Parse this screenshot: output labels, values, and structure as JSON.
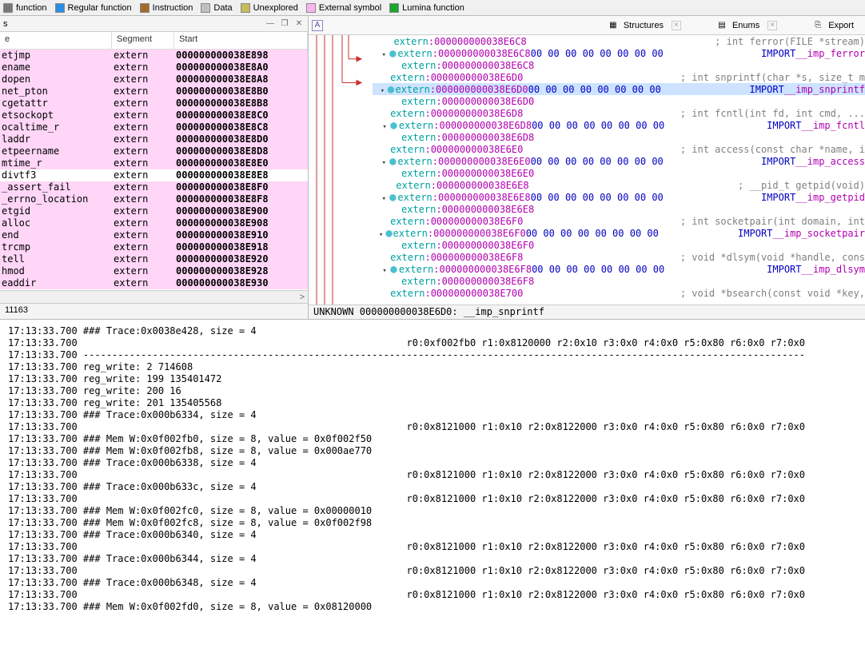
{
  "legend": [
    {
      "label": "function",
      "color": "#777777"
    },
    {
      "label": "Regular function",
      "color": "#2b8de6"
    },
    {
      "label": "Instruction",
      "color": "#a56a2a"
    },
    {
      "label": "Data",
      "color": "#c0c0c0"
    },
    {
      "label": "Unexplored",
      "color": "#c8bb5a"
    },
    {
      "label": "External symbol",
      "color": "#f7b6ef"
    },
    {
      "label": "Lumina function",
      "color": "#19a62a"
    }
  ],
  "left": {
    "title": "s",
    "headers": {
      "name": "e",
      "seg": "Segment",
      "start": "Start"
    },
    "rows": [
      {
        "n": "etjmp",
        "s": "extern",
        "a": "000000000038E898",
        "hl": true
      },
      {
        "n": "ename",
        "s": "extern",
        "a": "000000000038E8A0",
        "hl": true
      },
      {
        "n": "dopen",
        "s": "extern",
        "a": "000000000038E8A8",
        "hl": true
      },
      {
        "n": "net_pton",
        "s": "extern",
        "a": "000000000038E8B0",
        "hl": true
      },
      {
        "n": "cgetattr",
        "s": "extern",
        "a": "000000000038E8B8",
        "hl": true
      },
      {
        "n": "etsockopt",
        "s": "extern",
        "a": "000000000038E8C0",
        "hl": true
      },
      {
        "n": "ocaltime_r",
        "s": "extern",
        "a": "000000000038E8C8",
        "hl": true
      },
      {
        "n": "laddr",
        "s": "extern",
        "a": "000000000038E8D0",
        "hl": true
      },
      {
        "n": "etpeername",
        "s": "extern",
        "a": "000000000038E8D8",
        "hl": true
      },
      {
        "n": "mtime_r",
        "s": "extern",
        "a": "000000000038E8E0",
        "hl": true
      },
      {
        "n": "divtf3",
        "s": "extern",
        "a": "000000000038E8E8",
        "hl": false
      },
      {
        "n": "_assert_fail",
        "s": "extern",
        "a": "000000000038E8F0",
        "hl": true
      },
      {
        "n": "_errno_location",
        "s": "extern",
        "a": "000000000038E8F8",
        "hl": true
      },
      {
        "n": "etgid",
        "s": "extern",
        "a": "000000000038E900",
        "hl": true
      },
      {
        "n": "alloc",
        "s": "extern",
        "a": "000000000038E908",
        "hl": true
      },
      {
        "n": "end",
        "s": "extern",
        "a": "000000000038E910",
        "hl": true
      },
      {
        "n": "trcmp",
        "s": "extern",
        "a": "000000000038E918",
        "hl": true
      },
      {
        "n": "tell",
        "s": "extern",
        "a": "000000000038E920",
        "hl": true
      },
      {
        "n": "hmod",
        "s": "extern",
        "a": "000000000038E928",
        "hl": true
      },
      {
        "n": "eaddir",
        "s": "extern",
        "a": "000000000038E930",
        "hl": true
      }
    ],
    "status": "11163"
  },
  "tabs": [
    {
      "name": "Structures"
    },
    {
      "name": "Enums"
    },
    {
      "name": "Export"
    }
  ],
  "disasm": {
    "lines": [
      {
        "addr": "000000000038E6C8",
        "extra": "",
        "cmt": "; int ferror(FILE *stream)",
        "chev": false,
        "bul": false
      },
      {
        "addr": "000000000038E6C8",
        "bytes": "00 00 00 00 00 00 00 00",
        "imp": "__imp_ferror",
        "chev": true,
        "bul": "cy"
      },
      {
        "addr": "000000000038E6C8",
        "extra": "",
        "chev": false,
        "bul": false
      },
      {
        "addr": "000000000038E6D0",
        "extra": "",
        "cmt": "; int snprintf(char *s, size_t m",
        "chev": false,
        "bul": false
      },
      {
        "addr": "000000000038E6D0",
        "bytes": "00 00 00 00 00 00 00 00",
        "imp": "__imp_snprintf",
        "chev": true,
        "bul": "cy",
        "sel": true
      },
      {
        "addr": "000000000038E6D0",
        "extra": "",
        "chev": false,
        "bul": false
      },
      {
        "addr": "000000000038E6D8",
        "extra": "",
        "cmt": "; int fcntl(int fd, int cmd, ...",
        "chev": false,
        "bul": false
      },
      {
        "addr": "000000000038E6D8",
        "bytes": "00 00 00 00 00 00 00 00",
        "imp": "__imp_fcntl",
        "chev": true,
        "bul": "cy"
      },
      {
        "addr": "000000000038E6D8",
        "extra": "",
        "chev": false,
        "bul": false
      },
      {
        "addr": "000000000038E6E0",
        "extra": "",
        "cmt": "; int access(const char *name, i",
        "chev": false,
        "bul": false
      },
      {
        "addr": "000000000038E6E0",
        "bytes": "00 00 00 00 00 00 00 00",
        "imp": "__imp_access",
        "chev": true,
        "bul": "cy"
      },
      {
        "addr": "000000000038E6E0",
        "extra": "",
        "chev": false,
        "bul": false
      },
      {
        "addr": "000000000038E6E8",
        "extra": "",
        "cmt": "; __pid_t getpid(void)",
        "chev": false,
        "bul": false
      },
      {
        "addr": "000000000038E6E8",
        "bytes": "00 00 00 00 00 00 00 00",
        "imp": "__imp_getpid",
        "chev": true,
        "bul": "cy"
      },
      {
        "addr": "000000000038E6E8",
        "extra": "",
        "chev": false,
        "bul": false
      },
      {
        "addr": "000000000038E6F0",
        "extra": "",
        "cmt": "; int socketpair(int domain, int",
        "chev": false,
        "bul": false
      },
      {
        "addr": "000000000038E6F0",
        "bytes": "00 00 00 00 00 00 00 00",
        "imp": "__imp_socketpair",
        "chev": true,
        "bul": "cy"
      },
      {
        "addr": "000000000038E6F0",
        "extra": "",
        "chev": false,
        "bul": false
      },
      {
        "addr": "000000000038E6F8",
        "extra": "",
        "cmt": "; void *dlsym(void *handle, cons",
        "chev": false,
        "bul": false
      },
      {
        "addr": "000000000038E6F8",
        "bytes": "00 00 00 00 00 00 00 00",
        "imp": "__imp_dlsym",
        "chev": true,
        "bul": "cy"
      },
      {
        "addr": "000000000038E6F8",
        "extra": "",
        "chev": false,
        "bul": false
      },
      {
        "addr": "000000000038E700",
        "extra": "",
        "cmt": "; void *bsearch(const void *key,",
        "chev": false,
        "bul": false
      }
    ],
    "status": "UNKNOWN 000000000038E6D0: __imp_snprintf"
  },
  "log": [
    "17:13:33.700 ### Trace:0x0038e428, size = 4",
    "17:13:33.700                                                         r0:0xf002fb0 r1:0x8120000 r2:0x10 r3:0x0 r4:0x0 r5:0x80 r6:0x0 r7:0x0",
    "17:13:33.700 -----------------------------------------------------------------------------------------------------------------------------",
    "17:13:33.700 reg_write: 2 714608",
    "17:13:33.700 reg_write: 199 135401472",
    "17:13:33.700 reg_write: 200 16",
    "17:13:33.700 reg_write: 201 135405568",
    "17:13:33.700 ### Trace:0x000b6334, size = 4",
    "17:13:33.700                                                         r0:0x8121000 r1:0x10 r2:0x8122000 r3:0x0 r4:0x0 r5:0x80 r6:0x0 r7:0x0",
    "17:13:33.700 ### Mem W:0x0f002fb0, size = 8, value = 0x0f002f50",
    "17:13:33.700 ### Mem W:0x0f002fb8, size = 8, value = 0x000ae770",
    "17:13:33.700 ### Trace:0x000b6338, size = 4",
    "17:13:33.700                                                         r0:0x8121000 r1:0x10 r2:0x8122000 r3:0x0 r4:0x0 r5:0x80 r6:0x0 r7:0x0",
    "17:13:33.700 ### Trace:0x000b633c, size = 4",
    "17:13:33.700                                                         r0:0x8121000 r1:0x10 r2:0x8122000 r3:0x0 r4:0x0 r5:0x80 r6:0x0 r7:0x0",
    "17:13:33.700 ### Mem W:0x0f002fc0, size = 8, value = 0x00000010",
    "17:13:33.700 ### Mem W:0x0f002fc8, size = 8, value = 0x0f002f98",
    "17:13:33.700 ### Trace:0x000b6340, size = 4",
    "17:13:33.700                                                         r0:0x8121000 r1:0x10 r2:0x8122000 r3:0x0 r4:0x0 r5:0x80 r6:0x0 r7:0x0",
    "17:13:33.700 ### Trace:0x000b6344, size = 4",
    "17:13:33.700                                                         r0:0x8121000 r1:0x10 r2:0x8122000 r3:0x0 r4:0x0 r5:0x80 r6:0x0 r7:0x0",
    "17:13:33.700 ### Trace:0x000b6348, size = 4",
    "17:13:33.700                                                         r0:0x8121000 r1:0x10 r2:0x8122000 r3:0x0 r4:0x0 r5:0x80 r6:0x0 r7:0x0",
    "17:13:33.700 ### Mem W:0x0f002fd0, size = 8, value = 0x08120000"
  ]
}
